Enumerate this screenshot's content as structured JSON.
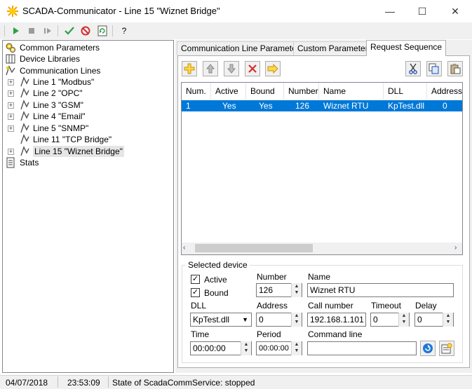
{
  "window": {
    "title": "SCADA-Communicator - Line 15 \"Wiznet Bridge\"",
    "minimize": "—",
    "maximize": "☐",
    "close": "✕"
  },
  "toolbar": {
    "help_glyph": "?"
  },
  "tree": {
    "common_parameters": "Common Parameters",
    "device_libraries": "Device Libraries",
    "communication_lines": "Communication Lines",
    "lines": [
      {
        "label": "Line 1 \"Modbus\"",
        "expandable": true
      },
      {
        "label": "Line 2 \"OPC\"",
        "expandable": true
      },
      {
        "label": "Line 3 \"GSM\"",
        "expandable": true
      },
      {
        "label": "Line 4 \"Email\"",
        "expandable": true
      },
      {
        "label": "Line 5 \"SNMP\"",
        "expandable": true
      },
      {
        "label": "Line 11 \"TCP Bridge\"",
        "expandable": false
      },
      {
        "label": "Line 15 \"Wiznet Bridge\"",
        "expandable": true
      }
    ],
    "stats": "Stats"
  },
  "tabs": [
    {
      "label": "Communication Line Parameters",
      "active": false
    },
    {
      "label": "Custom Parameters",
      "active": false
    },
    {
      "label": "Request Sequence",
      "active": true
    }
  ],
  "list": {
    "columns": [
      "Num.",
      "Active",
      "Bound",
      "Number",
      "Name",
      "DLL",
      "Address"
    ],
    "rows": [
      [
        "1",
        "Yes",
        "Yes",
        "126",
        "Wiznet RTU",
        "KpTest.dll",
        "0"
      ]
    ]
  },
  "selected_device": {
    "group_title": "Selected device",
    "active_label": "Active",
    "active_checked": true,
    "bound_label": "Bound",
    "bound_checked": true,
    "number_label": "Number",
    "number_value": "126",
    "name_label": "Name",
    "name_value": "Wiznet RTU",
    "dll_label": "DLL",
    "dll_value": "KpTest.dll",
    "address_label": "Address",
    "address_value": "0",
    "call_number_label": "Call number",
    "call_number_value": "192.168.1.101",
    "timeout_label": "Timeout",
    "timeout_value": "0",
    "delay_label": "Delay",
    "delay_value": "0",
    "time_label": "Time",
    "time_value": "00:00:00",
    "period_label": "Period",
    "period_value": "00:00:00",
    "command_line_label": "Command line",
    "command_line_value": ""
  },
  "status": {
    "date": "04/07/2018",
    "time": "23:53:09",
    "service_state": "State of ScadaCommService: stopped"
  }
}
